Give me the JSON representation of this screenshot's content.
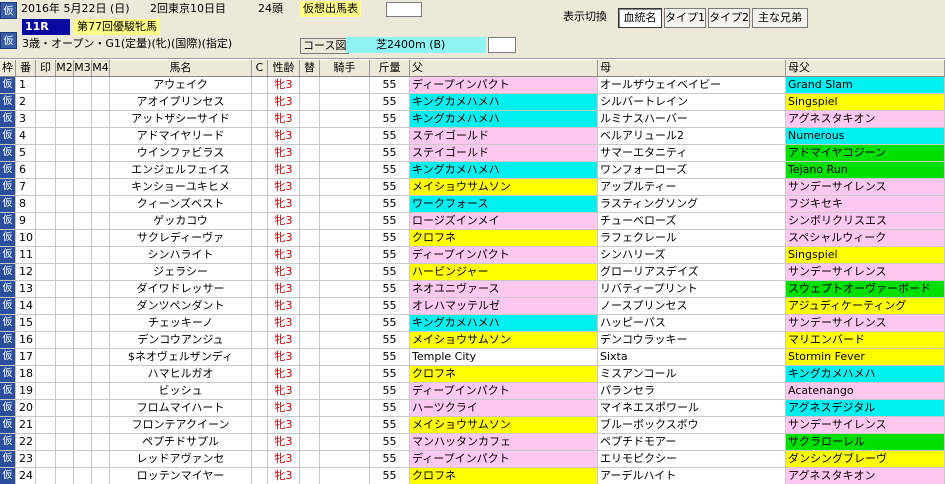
{
  "header": {
    "date": "2016年 5月22日 (日)",
    "meeting": "2回東京10日目",
    "count": "24頭",
    "mode": "仮想出馬表",
    "race_no": "11R",
    "race_name": "第77回優駿牝馬",
    "conditions": "3歳・オープン・G1(定量)(牝)(国際)(指定)",
    "course_label": "コース図",
    "course": "芝2400m (B)",
    "side_icon_1": "仮",
    "side_icon_2": "仮"
  },
  "toolbar": {
    "display_switch": "表示切換",
    "tabs": [
      "血統名",
      "タイプ1",
      "タイプ2",
      "主な兄弟"
    ],
    "active": "血統名"
  },
  "columns": {
    "waku": "枠",
    "ban": "番",
    "mark": "印",
    "m2": "M2",
    "m3": "M3",
    "m4": "M4",
    "name": "馬名",
    "c": "C",
    "sexage": "性齢",
    "chg": "替",
    "jockey": "騎手",
    "weight": "斤量",
    "sire": "父",
    "dam": "母",
    "bms": "母父"
  },
  "colors": {
    "pink": "#ffc8f0",
    "cyan": "#00f0f0",
    "yellow": "#ffff00",
    "green": "#00e000",
    "blue": "#0000cc"
  },
  "horses": [
    {
      "waku": "仮",
      "no": "1",
      "name": "アウェイク",
      "sex": "牝3",
      "wt": "55",
      "sire": "ディープインパクト",
      "sire_c": "pink",
      "dam": "オールザウェイベイビー",
      "bms": "Grand Slam",
      "bms_c": "cyan"
    },
    {
      "waku": "仮",
      "no": "2",
      "name": "アオイプリンセス",
      "sex": "牝3",
      "wt": "55",
      "sire": "キングカメハメハ",
      "sire_c": "cyan",
      "dam": "シルバートレイン",
      "bms": "Singspiel",
      "bms_c": "yellow"
    },
    {
      "waku": "仮",
      "no": "3",
      "name": "アットザシーサイド",
      "sex": "牝3",
      "wt": "55",
      "sire": "キングカメハメハ",
      "sire_c": "cyan",
      "dam": "ルミナスハーバー",
      "bms": "アグネスタキオン",
      "bms_c": "pink"
    },
    {
      "waku": "仮",
      "no": "4",
      "name": "アドマイヤリード",
      "sex": "牝3",
      "wt": "55",
      "sire": "ステイゴールド",
      "sire_c": "pink",
      "dam": "ベルアリュール2",
      "bms": "Numerous",
      "bms_c": "cyan"
    },
    {
      "waku": "仮",
      "no": "5",
      "name": "ウインファビラス",
      "sex": "牝3",
      "wt": "55",
      "sire": "ステイゴールド",
      "sire_c": "pink",
      "dam": "サマーエタニティ",
      "bms": "アドマイヤコジーン",
      "bms_c": "green"
    },
    {
      "waku": "仮",
      "no": "6",
      "name": "エンジェルフェイス",
      "sex": "牝3",
      "wt": "55",
      "sire": "キングカメハメハ",
      "sire_c": "cyan",
      "dam": "ワンフォーローズ",
      "bms": "Tejano Run",
      "bms_c": "green"
    },
    {
      "waku": "仮",
      "no": "7",
      "name": "キンショーユキヒメ",
      "sex": "牝3",
      "wt": "55",
      "sire": "メイショウサムソン",
      "sire_c": "yellow",
      "dam": "アップルティー",
      "bms": "サンデーサイレンス",
      "bms_c": "pink"
    },
    {
      "waku": "仮",
      "no": "8",
      "name": "クィーンズベスト",
      "sex": "牝3",
      "wt": "55",
      "sire": "ワークフォース",
      "sire_c": "cyan",
      "dam": "ラスティングソング",
      "bms": "フジキセキ",
      "bms_c": "pink"
    },
    {
      "waku": "仮",
      "no": "9",
      "name": "ゲッカコウ",
      "sex": "牝3",
      "wt": "55",
      "sire": "ロージズインメイ",
      "sire_c": "pink",
      "dam": "チューベローズ",
      "bms": "シンボリクリスエス",
      "bms_c": "pink"
    },
    {
      "waku": "仮",
      "no": "10",
      "name": "サクレディーヴァ",
      "sex": "牝3",
      "wt": "55",
      "sire": "クロフネ",
      "sire_c": "yellow",
      "dam": "ラフェクレール",
      "bms": "スペシャルウィーク",
      "bms_c": "pink"
    },
    {
      "waku": "仮",
      "no": "11",
      "name": "シンハライト",
      "sex": "牝3",
      "wt": "55",
      "sire": "ディープインパクト",
      "sire_c": "pink",
      "dam": "シンハリーズ",
      "bms": "Singspiel",
      "bms_c": "yellow"
    },
    {
      "waku": "仮",
      "no": "12",
      "name": "ジェラシー",
      "sex": "牝3",
      "wt": "55",
      "sire": "ハービンジャー",
      "sire_c": "yellow",
      "dam": "グローリアスデイズ",
      "bms": "サンデーサイレンス",
      "bms_c": "pink"
    },
    {
      "waku": "仮",
      "no": "13",
      "name": "ダイワドレッサー",
      "sex": "牝3",
      "wt": "55",
      "sire": "ネオユニヴァース",
      "sire_c": "pink",
      "dam": "リバティープリント",
      "bms": "スウェプトオーヴァーボード",
      "bms_c": "green"
    },
    {
      "waku": "仮",
      "no": "14",
      "name": "ダンツペンダント",
      "sex": "牝3",
      "wt": "55",
      "sire": "オレハマッテルゼ",
      "sire_c": "pink",
      "dam": "ノースプリンセス",
      "bms": "アジュディケーティング",
      "bms_c": "yellow"
    },
    {
      "waku": "仮",
      "no": "15",
      "name": "チェッキーノ",
      "sex": "牝3",
      "wt": "55",
      "sire": "キングカメハメハ",
      "sire_c": "cyan",
      "dam": "ハッピーパス",
      "bms": "サンデーサイレンス",
      "bms_c": "pink"
    },
    {
      "waku": "仮",
      "no": "16",
      "name": "デンコウアンジュ",
      "sex": "牝3",
      "wt": "55",
      "sire": "メイショウサムソン",
      "sire_c": "yellow",
      "dam": "デンコウラッキー",
      "bms": "マリエンバード",
      "bms_c": "yellow"
    },
    {
      "waku": "仮",
      "no": "17",
      "name": "$ネオヴェルザンディ",
      "sex": "牝3",
      "wt": "55",
      "sire": "Temple City",
      "sire_c": "none",
      "dam": "Sixta",
      "bms": "Stormin Fever",
      "bms_c": "yellow"
    },
    {
      "waku": "仮",
      "no": "18",
      "name": "ハマヒルガオ",
      "sex": "牝3",
      "wt": "55",
      "sire": "クロフネ",
      "sire_c": "yellow",
      "dam": "ミスアンコール",
      "bms": "キングカメハメハ",
      "bms_c": "cyan"
    },
    {
      "waku": "仮",
      "no": "19",
      "name": "ビッシュ",
      "sex": "牝3",
      "wt": "55",
      "sire": "ディープインパクト",
      "sire_c": "pink",
      "dam": "パランセラ",
      "bms": "Acatenango",
      "bms_c": "pink"
    },
    {
      "waku": "仮",
      "no": "20",
      "name": "フロムマイハート",
      "sex": "牝3",
      "wt": "55",
      "sire": "ハーツクライ",
      "sire_c": "pink",
      "dam": "マイネエスポワール",
      "bms": "アグネスデジタル",
      "bms_c": "cyan"
    },
    {
      "waku": "仮",
      "no": "21",
      "name": "フロンテアクイーン",
      "sex": "牝3",
      "wt": "55",
      "sire": "メイショウサムソン",
      "sire_c": "yellow",
      "dam": "ブルーボックスボウ",
      "bms": "サンデーサイレンス",
      "bms_c": "pink"
    },
    {
      "waku": "仮",
      "no": "22",
      "name": "ペプチドサプル",
      "sex": "牝3",
      "wt": "55",
      "sire": "マンハッタンカフェ",
      "sire_c": "pink",
      "dam": "ペプチドモアー",
      "bms": "サクラローレル",
      "bms_c": "green"
    },
    {
      "waku": "仮",
      "no": "23",
      "name": "レッドアヴァンセ",
      "sex": "牝3",
      "wt": "55",
      "sire": "ディープインパクト",
      "sire_c": "pink",
      "dam": "エリモピクシー",
      "bms": "ダンシングブレーヴ",
      "bms_c": "yellow"
    },
    {
      "waku": "仮",
      "no": "24",
      "name": "ロッテンマイヤー",
      "sex": "牝3",
      "wt": "55",
      "sire": "クロフネ",
      "sire_c": "yellow",
      "dam": "アーデルハイト",
      "bms": "アグネスタキオン",
      "bms_c": "pink"
    }
  ]
}
